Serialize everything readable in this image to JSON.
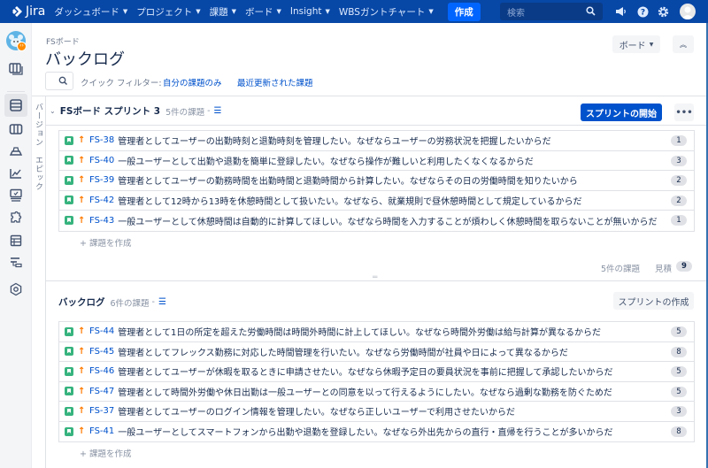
{
  "topnav": {
    "logo": "Jira",
    "items": [
      {
        "label": "ダッシュボード",
        "chevron": "chevron-down"
      },
      {
        "label": "プロジェクト",
        "chevron": "chevron-down"
      },
      {
        "label": "課題",
        "chevron": "chevron-down"
      },
      {
        "label": "ボード",
        "chevron": "chevron-down"
      },
      {
        "label": "Insight",
        "chevron": "chevron-down"
      },
      {
        "label": "WBSガントチャート",
        "chevron": "chevron-down"
      }
    ],
    "create_label": "作成",
    "search_placeholder": "検索",
    "icons": [
      "megaphone-icon",
      "help-icon",
      "gear-icon",
      "user-avatar"
    ]
  },
  "sidebar": {
    "project_badge": "",
    "items": [
      "board-icon",
      "backlog-icon",
      "columns-icon",
      "releases-icon",
      "reports-icon",
      "monitor-icon",
      "addon-icon",
      "table-icon",
      "gantt-icon",
      "settings-icon"
    ],
    "active": "backlog-icon"
  },
  "vertical_tabs": [
    "バージョン",
    "エピック"
  ],
  "header": {
    "breadcrumb": "FSボード",
    "title": "バックログ",
    "board_button": "ボード",
    "quick_filter_label": "クイック フィルター:",
    "quick_filters": [
      "自分の課題のみ",
      "最近更新された課題"
    ]
  },
  "sprint": {
    "title": "FSボード スプリント 3",
    "count": "5件の課題",
    "start_button": "スプリントの開始",
    "more_button": "•••",
    "issues": [
      {
        "key": "FS-38",
        "summary": "管理者としてユーザーの出勤時刻と退勤時刻を管理したい。なぜならユーザーの労務状況を把握したいからだ",
        "estimate": "1"
      },
      {
        "key": "FS-40",
        "summary": "一般ユーザーとして出勤や退勤を簡単に登録したい。なぜなら操作が難しいと利用したくなくなるからだ",
        "estimate": "3"
      },
      {
        "key": "FS-39",
        "summary": "管理者としてユーザーの勤務時間を出勤時間と退勤時間から計算したい。なぜならその日の労働時間を知りたいから",
        "estimate": "2"
      },
      {
        "key": "FS-42",
        "summary": "管理者として12時から13時を休憩時間として扱いたい。なぜなら、就業規則で昼休憩時間として規定しているからだ",
        "estimate": "2"
      },
      {
        "key": "FS-43",
        "summary": "一般ユーザーとして休憩時間は自動的に計算してほしい。なぜなら時間を入力することが煩わしく休憩時間を取らないことが無いからだ",
        "estimate": "1"
      }
    ],
    "create_issue": "+ 課題を作成",
    "footer_count": "5件の課題",
    "footer_estimate_label": "見積",
    "footer_estimate": "9"
  },
  "backlog": {
    "title": "バックログ",
    "count": "6件の課題",
    "create_sprint_button": "スプリントの作成",
    "issues": [
      {
        "key": "FS-44",
        "summary": "管理者として1日の所定を超えた労働時間は時間外時間に計上してほしい。なぜなら時間外労働は給与計算が異なるからだ",
        "estimate": "5"
      },
      {
        "key": "FS-45",
        "summary": "管理者としてフレックス勤務に対応した時間管理を行いたい。なぜなら労働時間が社員や日によって異なるからだ",
        "estimate": "8"
      },
      {
        "key": "FS-46",
        "summary": "管理者としてユーザーが休暇を取るときに申請させたい。なぜなら休暇予定日の要員状況を事前に把握して承認したいからだ",
        "estimate": "5"
      },
      {
        "key": "FS-47",
        "summary": "管理者として時間外労働や休日出勤は一般ユーザーとの同意を以って行えるようにしたい。なぜなら過剰な勤務を防ぐためだ",
        "estimate": "5"
      },
      {
        "key": "FS-37",
        "summary": "管理者としてユーザーのログイン情報を管理したい。なぜなら正しいユーザーで利用させたいからだ",
        "estimate": "3"
      },
      {
        "key": "FS-41",
        "summary": "一般ユーザーとしてスマートフォンから出勤や退勤を登録したい。なぜなら外出先からの直行・直帰を行うことが多いからだ",
        "estimate": "8"
      }
    ],
    "create_issue": "+ 課題を作成"
  },
  "colors": {
    "nav_bg": "#0747a6",
    "primary": "#0052cc",
    "story": "#36b37e",
    "priority": "#ff7a00"
  }
}
